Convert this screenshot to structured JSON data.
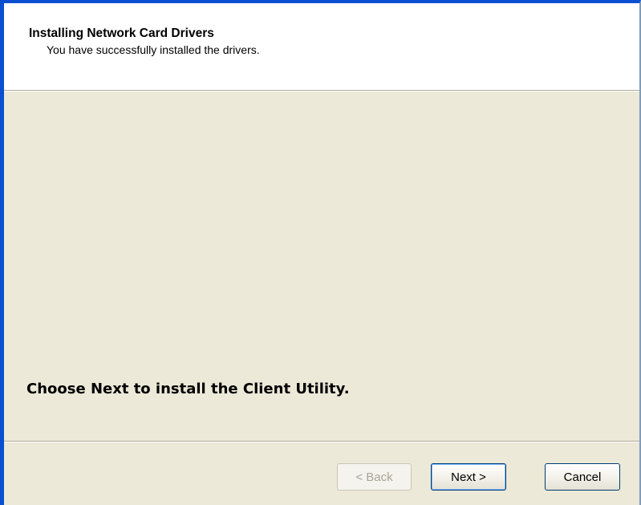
{
  "header": {
    "title": "Installing Network Card Drivers",
    "subtitle": "You have successfully installed the drivers."
  },
  "main": {
    "instruction": "Choose Next to install the Client Utility."
  },
  "footer": {
    "back_label": "< Back",
    "next_label": "Next >",
    "cancel_label": "Cancel",
    "back_enabled": false
  },
  "colors": {
    "window_border": "#0a4fd1",
    "header_background": "#ffffff",
    "dialog_background": "#ece9d8",
    "disabled_text": "#a7a592"
  }
}
